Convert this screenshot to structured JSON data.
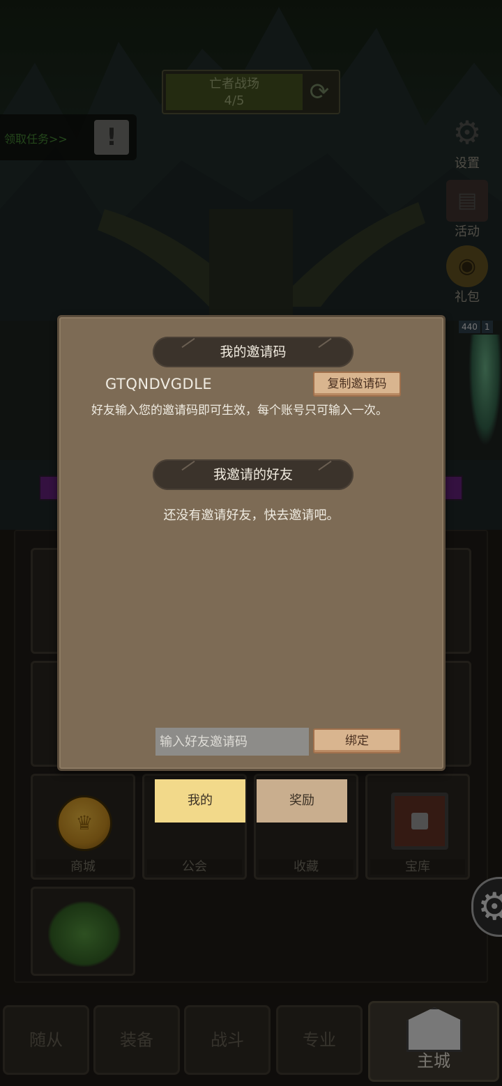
{
  "battle": {
    "name": "亡者战场",
    "progress": "4/5"
  },
  "task": {
    "label": "领取任务>>"
  },
  "side_menu": [
    {
      "label": "设置",
      "icon": "gear-icon"
    },
    {
      "label": "活动",
      "icon": "scroll-icon"
    },
    {
      "label": "礼包",
      "icon": "gift-icon"
    }
  ],
  "enemy": {
    "level_left": "440",
    "level_right": "1"
  },
  "buildings": [
    {
      "label": "商城",
      "icon": "coin-icon"
    },
    {
      "label": "公会",
      "icon": "guild-icon"
    },
    {
      "label": "收藏",
      "icon": "collection-icon"
    },
    {
      "label": "宝库",
      "icon": "chest-icon"
    }
  ],
  "nav": [
    {
      "label": "随从"
    },
    {
      "label": "装备"
    },
    {
      "label": "战斗"
    },
    {
      "label": "专业"
    },
    {
      "label": "主城",
      "active": true
    }
  ],
  "dialog": {
    "my_code_title": "我的邀请码",
    "invite_code": "GTQNDVGDLE",
    "copy_button": "复制邀请码",
    "hint": "好友输入您的邀请码即可生效，每个账号只可输入一次。",
    "friends_title": "我邀请的好友",
    "empty_text": "还没有邀请好友，快去邀请吧。",
    "input_placeholder": "输入好友邀请码",
    "bind_button": "绑定"
  },
  "tabs": [
    {
      "label": "我的",
      "active": true
    },
    {
      "label": "奖励",
      "active": false
    }
  ],
  "colors": {
    "dialog_bg": "#7d6b55",
    "pill_bg": "#3b332b",
    "wood_button": "#d9b58f",
    "tab_active": "#f2d98a",
    "tab_inactive": "#c9ae8e"
  }
}
